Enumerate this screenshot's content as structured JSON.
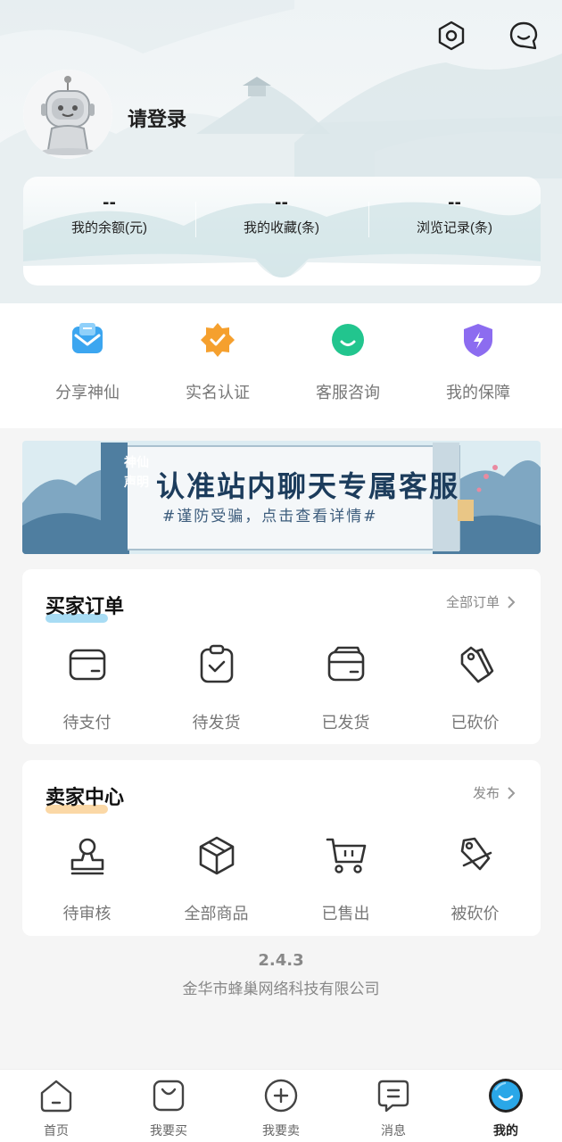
{
  "header": {
    "login_text": "请登录",
    "settings_icon": "hex-settings-icon",
    "service_icon": "chat-bubble-icon"
  },
  "stats": [
    {
      "value": "--",
      "label": "我的余额(元)"
    },
    {
      "value": "--",
      "label": "我的收藏(条)"
    },
    {
      "value": "--",
      "label": "浏览记录(条)"
    }
  ],
  "quick_actions": [
    {
      "label": "分享神仙",
      "icon": "share-mail-icon",
      "color": "#3ca6f0"
    },
    {
      "label": "实名认证",
      "icon": "verified-badge-icon",
      "color": "#f5a02e"
    },
    {
      "label": "客服咨询",
      "icon": "customer-service-icon",
      "color": "#22c58e"
    },
    {
      "label": "我的保障",
      "icon": "shield-icon",
      "color": "#8c6cf0"
    }
  ],
  "banner": {
    "title": "认准站内聊天专属客服",
    "subtitle": "#谨防受骗，点击查看详情#",
    "side_text": "神仙声明"
  },
  "buyer_orders": {
    "title": "买家订单",
    "link": "全部订单",
    "highlight_color": "#a8dcf4",
    "items": [
      {
        "label": "待支付",
        "icon": "card-icon"
      },
      {
        "label": "待发货",
        "icon": "clipboard-check-icon"
      },
      {
        "label": "已发货",
        "icon": "wallet-icon"
      },
      {
        "label": "已砍价",
        "icon": "price-tag-icon"
      }
    ]
  },
  "seller_center": {
    "title": "卖家中心",
    "link": "发布",
    "highlight_color": "#fbd8a6",
    "items": [
      {
        "label": "待审核",
        "icon": "stamp-icon"
      },
      {
        "label": "全部商品",
        "icon": "box-icon"
      },
      {
        "label": "已售出",
        "icon": "cart-icon"
      },
      {
        "label": "被砍价",
        "icon": "tag-cut-icon"
      }
    ]
  },
  "footer": {
    "version": "2.4.3",
    "company": "金华市蜂巢网络科技有限公司"
  },
  "bottom_nav": [
    {
      "label": "首页",
      "icon": "home-icon",
      "active": false
    },
    {
      "label": "我要买",
      "icon": "shopping-bag-icon",
      "active": false
    },
    {
      "label": "我要卖",
      "icon": "plus-circle-icon",
      "active": false
    },
    {
      "label": "消息",
      "icon": "message-icon",
      "active": false
    },
    {
      "label": "我的",
      "icon": "profile-icon",
      "active": true,
      "color": "#2aa7e8"
    }
  ]
}
